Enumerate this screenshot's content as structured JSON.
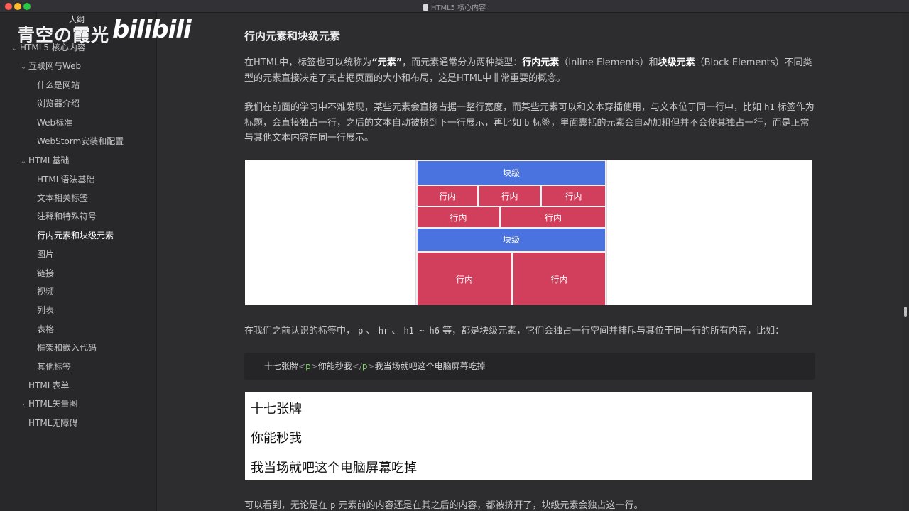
{
  "window": {
    "title": "HTML5 核心内容"
  },
  "logo": {
    "text": "青空の霞光",
    "small": "大纲",
    "bili": "bilibili"
  },
  "sidebar": {
    "items": [
      {
        "label": "HTML5 核心内容",
        "chevron": "⌄"
      },
      {
        "label": "互联网与Web",
        "chevron": "⌄"
      },
      {
        "label": "什么是网站"
      },
      {
        "label": "浏览器介绍"
      },
      {
        "label": "Web标准"
      },
      {
        "label": "WebStorm安装和配置"
      },
      {
        "label": "HTML基础",
        "chevron": "⌄"
      },
      {
        "label": "HTML语法基础"
      },
      {
        "label": "文本相关标签"
      },
      {
        "label": "注释和特殊符号"
      },
      {
        "label": "行内元素和块级元素",
        "active": true
      },
      {
        "label": "图片"
      },
      {
        "label": "链接"
      },
      {
        "label": "视频"
      },
      {
        "label": "列表"
      },
      {
        "label": "表格"
      },
      {
        "label": "框架和嵌入代码"
      },
      {
        "label": "其他标签"
      },
      {
        "label": "HTML表单"
      },
      {
        "label": "HTML矢量图",
        "chevron": "›"
      },
      {
        "label": "HTML无障碍"
      }
    ]
  },
  "article": {
    "heading": "行内元素和块级元素",
    "p1": {
      "a": "在HTML中，标签也可以统称为",
      "b1": "“元素”",
      "c": "，而元素通常分为两种类型：",
      "b2": "行内元素",
      "d": "（Inline Elements）和",
      "b3": "块级元素",
      "e": "（Block Elements）不同类型的元素直接决定了其占据页面的大小和布局，这是HTML中非常重要的概念。"
    },
    "p2": {
      "a": "我们在前面的学习中不难发现，某些元素会直接占据一整行宽度，而某些元素可以和文本穿插使用，与文本位于同一行中，比如",
      "code1": "h1",
      "b": "标签作为标题，会直接独占一行，之后的文本自动被挤到下一行展示，再比如",
      "code2": "b",
      "c": "标签，里面囊括的元素会自动加粗但并不会使其独占一行，而是正常与其他文本内容在同一行展示。"
    },
    "diagram": {
      "block_label": "块级",
      "inline_label": "行内"
    },
    "p3": {
      "a": "在我们之前认识的标签中，",
      "code1": "p",
      "sep1": "、",
      "code2": "hr",
      "sep2": "、",
      "code3": "h1 ~ h6",
      "b": "等，都是块级元素，它们会独占一行空间并排斥与其位于同一行的所有内容，比如："
    },
    "code": {
      "before": "十七张牌",
      "open_lt": "<",
      "tag": "p",
      "open_gt": ">",
      "inner": "你能秒我",
      "close_lt": "</",
      "close_gt": ">",
      "after": "我当场就吧这个电脑屏幕吃掉"
    },
    "render": {
      "line1": "十七张牌",
      "line2": "你能秒我",
      "line3": "我当场就吧这个电脑屏幕吃掉"
    },
    "p4": {
      "a": "可以看到，无论是在",
      "code1": "p",
      "b": "元素前的内容还是在其之后的内容，都被挤开了，块级元素会独占这一行。"
    }
  },
  "colors": {
    "block": "#4a73e0",
    "inline": "#d23f5c",
    "code_tag": "#7fd36a"
  }
}
